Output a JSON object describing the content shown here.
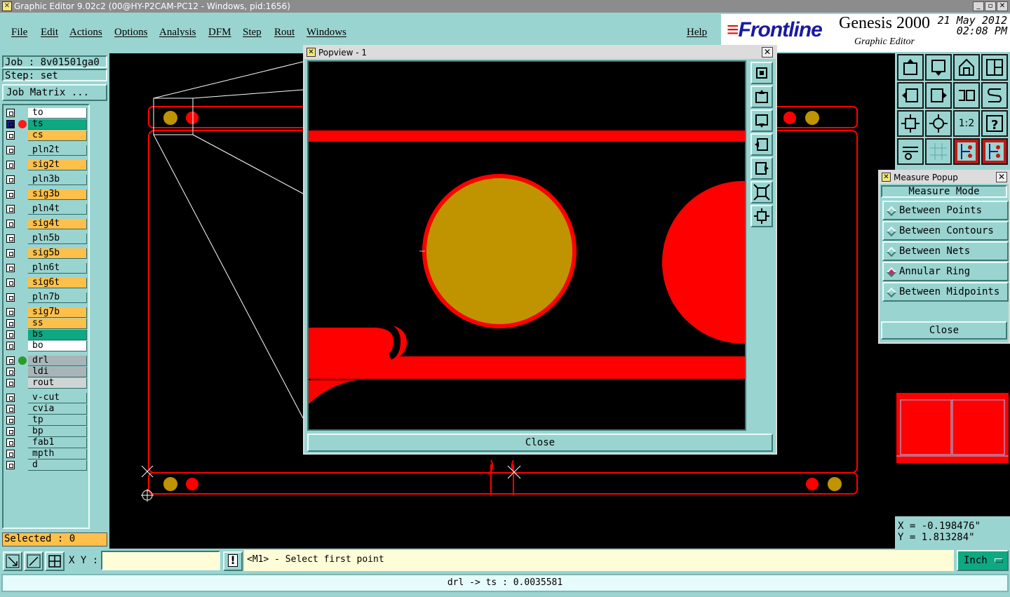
{
  "window": {
    "title": "Graphic Editor 9.02c2 (00@HY-P2CAM-PC12 - Windows, pid:1656)"
  },
  "menu": {
    "items": [
      "File",
      "Edit",
      "Actions",
      "Options",
      "Analysis",
      "DFM",
      "Step",
      "Rout",
      "Windows"
    ],
    "help": "Help"
  },
  "brand": {
    "logo": "Frontline",
    "product": "Genesis 2000",
    "subtitle": "Graphic Editor",
    "date": "21 May 2012",
    "time": "02:08 PM"
  },
  "job": {
    "job_label": "Job : 8v01501ga0",
    "step_label": "Step: set",
    "matrix_button": "Job Matrix ..."
  },
  "layers": [
    {
      "name": "to",
      "color": "#ffffff",
      "dot": ""
    },
    {
      "name": "ts",
      "color": "#0ea882",
      "dot": "#ff1a1a",
      "active": true
    },
    {
      "name": "cs",
      "color": "#ffc04a",
      "dot": ""
    },
    {
      "name": "pln2t",
      "color": "#9ad4d0",
      "dot": ""
    },
    {
      "name": "sig2t",
      "color": "#ffc04a",
      "dot": ""
    },
    {
      "name": "pln3b",
      "color": "#9ad4d0",
      "dot": ""
    },
    {
      "name": "sig3b",
      "color": "#ffc04a",
      "dot": ""
    },
    {
      "name": "pln4t",
      "color": "#9ad4d0",
      "dot": ""
    },
    {
      "name": "sig4t",
      "color": "#ffc04a",
      "dot": ""
    },
    {
      "name": "pln5b",
      "color": "#9ad4d0",
      "dot": ""
    },
    {
      "name": "sig5b",
      "color": "#ffc04a",
      "dot": ""
    },
    {
      "name": "pln6t",
      "color": "#9ad4d0",
      "dot": ""
    },
    {
      "name": "sig6t",
      "color": "#ffc04a",
      "dot": ""
    },
    {
      "name": "pln7b",
      "color": "#9ad4d0",
      "dot": ""
    },
    {
      "name": "sig7b",
      "color": "#ffc04a",
      "dot": ""
    },
    {
      "name": "ss",
      "color": "#ffc04a",
      "dot": ""
    },
    {
      "name": "bs",
      "color": "#0ea882",
      "dot": ""
    },
    {
      "name": "bo",
      "color": "#ffffff",
      "dot": ""
    },
    {
      "name": "drl",
      "color": "#a8b4b8",
      "dot": "#2a9a2a"
    },
    {
      "name": "ldi",
      "color": "#a8b4b8",
      "dot": ""
    },
    {
      "name": "rout",
      "color": "#cfd4d4",
      "dot": ""
    },
    {
      "name": "v-cut",
      "color": "#9ad4d0",
      "dot": ""
    },
    {
      "name": "cvia",
      "color": "#9ad4d0",
      "dot": ""
    },
    {
      "name": "tp",
      "color": "#9ad4d0",
      "dot": ""
    },
    {
      "name": "bp",
      "color": "#9ad4d0",
      "dot": ""
    },
    {
      "name": "fab1",
      "color": "#9ad4d0",
      "dot": ""
    },
    {
      "name": "mpth",
      "color": "#9ad4d0",
      "dot": ""
    },
    {
      "name": "d",
      "color": "#9ad4d0",
      "dot": ""
    }
  ],
  "selected": "Selected : 0",
  "popview": {
    "title": "Popview - 1",
    "close": "Close"
  },
  "measure": {
    "title": "Measure Popup",
    "heading": "Measure Mode",
    "options": [
      {
        "label": "Between Points",
        "selected": false
      },
      {
        "label": "Between Contours",
        "selected": false
      },
      {
        "label": "Between Nets",
        "selected": false
      },
      {
        "label": "Annular Ring",
        "selected": true
      },
      {
        "label": "Between Midpoints",
        "selected": false
      }
    ],
    "close": "Close"
  },
  "coords": {
    "x": "X = -0.198476\"",
    "y": "Y = 1.813284\""
  },
  "status": {
    "xy_label": "X Y :",
    "xy_value": "",
    "prompt": "<M1> - Select first point",
    "units": "Inch"
  },
  "message": "drl -> ts : 0.0035581",
  "colors": {
    "pad_red": "#ff0000",
    "pad_gold": "#c09400",
    "panel": "#9ad4d0"
  }
}
